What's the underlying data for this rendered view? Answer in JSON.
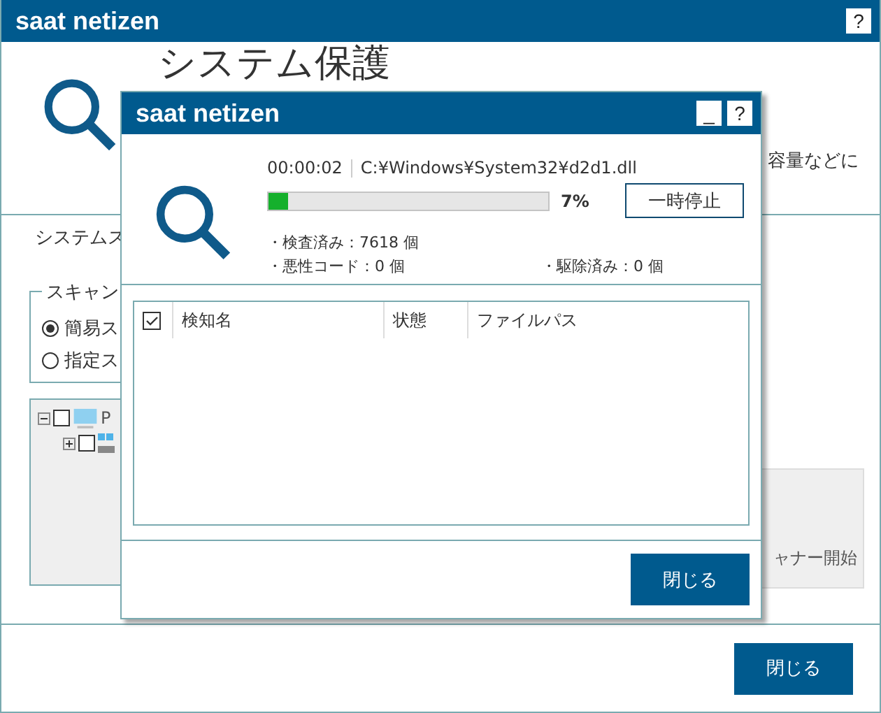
{
  "window": {
    "title": "saat netizen",
    "help_label": "?"
  },
  "header": {
    "title": "システム保護",
    "description": "容量などに"
  },
  "section_label": "システムス",
  "scan_group": {
    "legend": "スキャン",
    "options": [
      {
        "label": "簡易ス",
        "selected": true
      },
      {
        "label": "指定ス",
        "selected": false
      }
    ]
  },
  "tree": [
    {
      "label": "P",
      "expanded": true,
      "checked": false,
      "children": [
        {
          "expanded": false,
          "checked": false
        }
      ]
    }
  ],
  "scan_start_button": {
    "label": "ャナー開始"
  },
  "close_button": {
    "label": "閉じる"
  },
  "dialog": {
    "title": "saat netizen",
    "minimize_label": "_",
    "help_label": "?",
    "elapsed": "00:00:02",
    "current_file": "C:¥Windows¥System32¥d2d1.dll",
    "progress": {
      "level": 0.07,
      "reading": "7%"
    },
    "pause_button": {
      "label": "一時停止"
    },
    "stats": [
      {
        "label": "・検査済み：7618 個"
      },
      {
        "label": "・悪性コード：0 個"
      },
      {
        "label": "・駆除済み：0 個"
      }
    ],
    "table": {
      "select_all_checked": true,
      "columns": [
        "検知名",
        "状態",
        "ファイルパス"
      ]
    },
    "close_button": {
      "label": "閉じる"
    }
  }
}
